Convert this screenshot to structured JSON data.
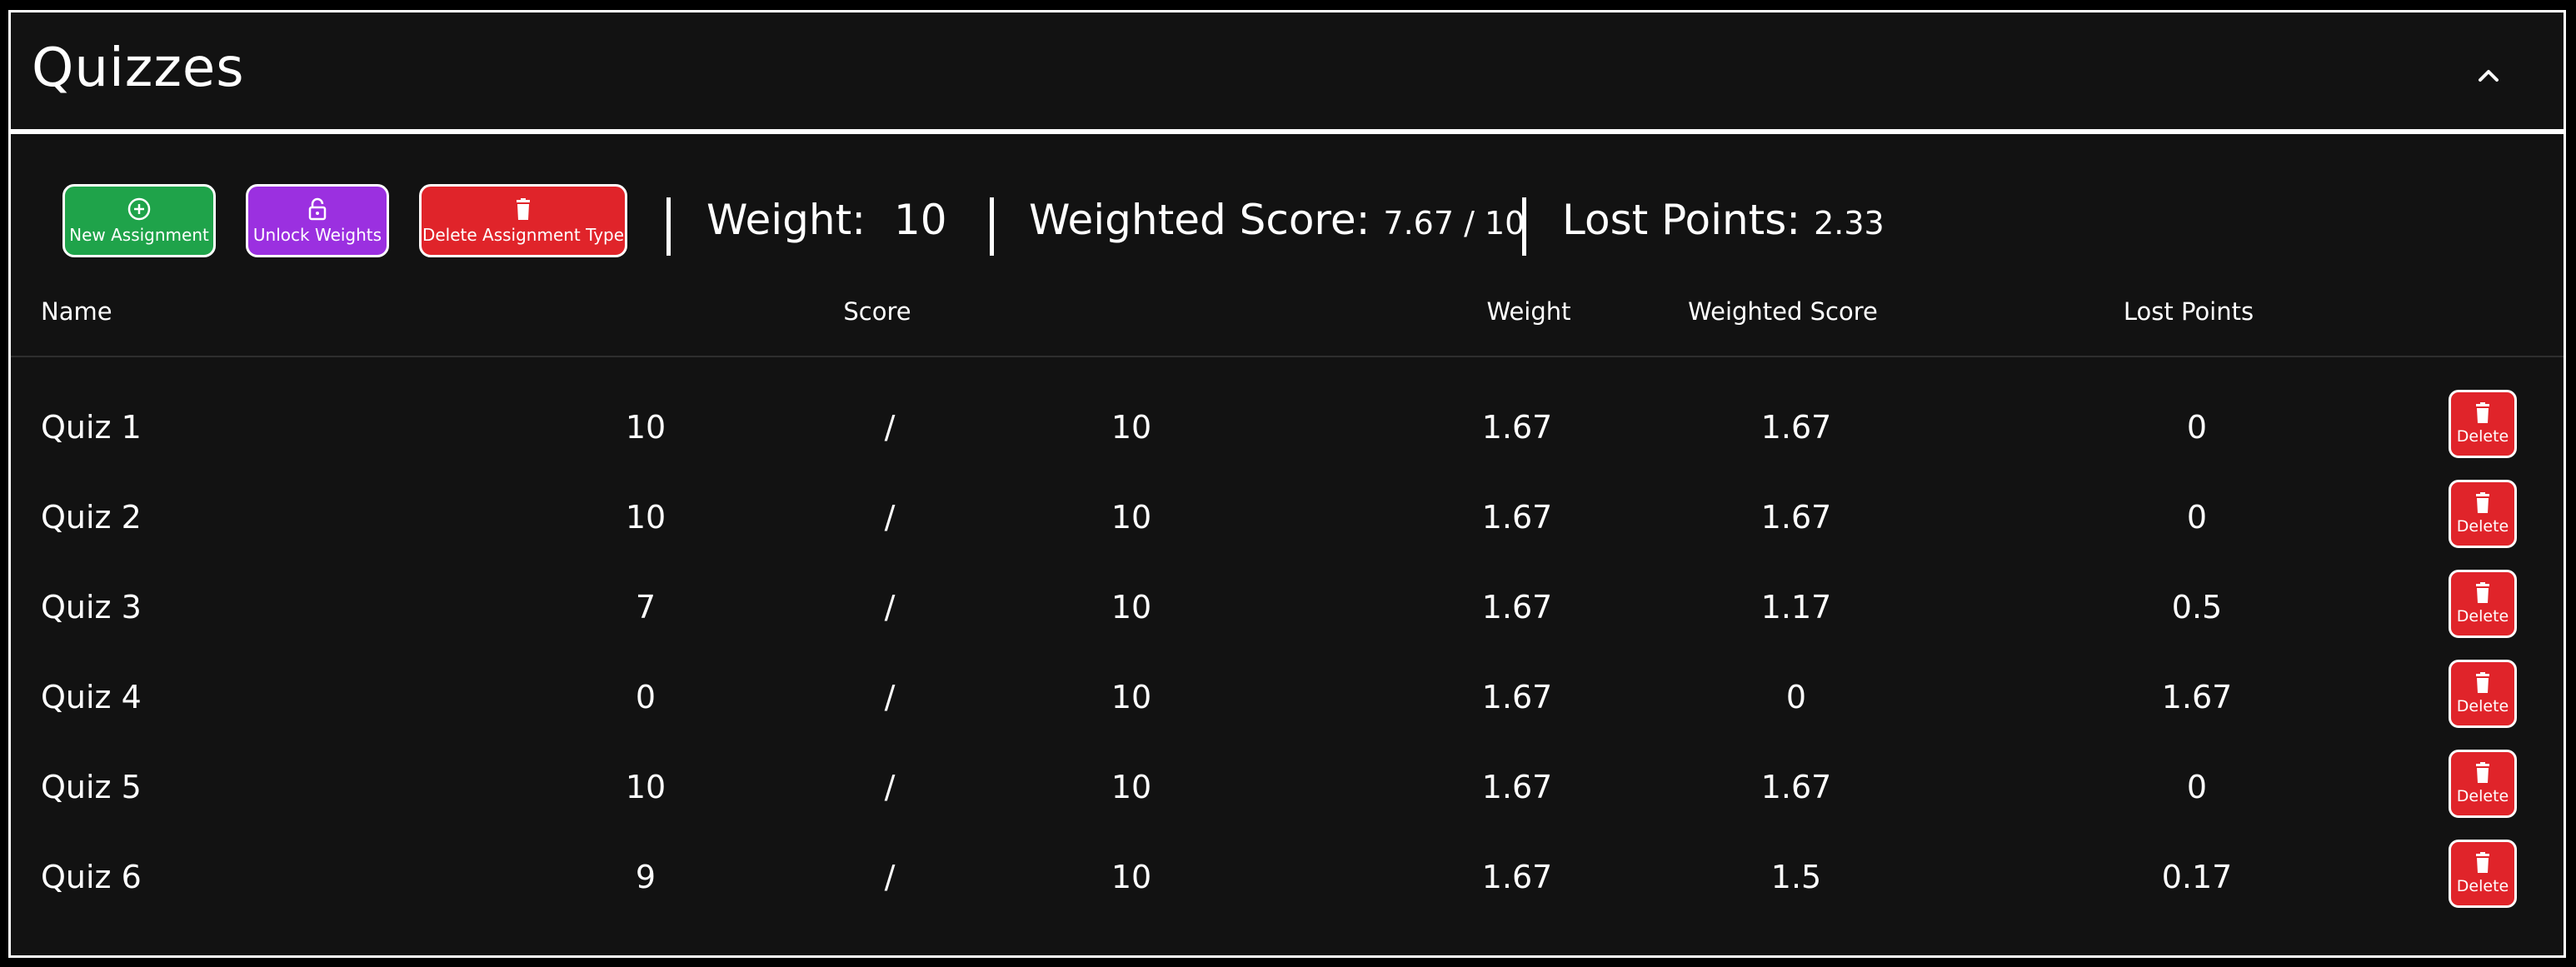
{
  "section": {
    "title": "Quizzes"
  },
  "toolbar": {
    "new_label": "New Assignment",
    "unlock_label": "Unlock Weights",
    "delete_type_label": "Delete Assignment Type",
    "weight_label": "Weight:",
    "weight_value": "10",
    "weighted_score_label": "Weighted Score:",
    "weighted_score_value": "7.67 / 10",
    "lost_points_label": "Lost Points:",
    "lost_points_value": "2.33"
  },
  "table": {
    "headers": {
      "name": "Name",
      "score": "Score",
      "weight": "Weight",
      "weighted_score": "Weighted Score",
      "lost_points": "Lost Points"
    },
    "delete_label": "Delete",
    "rows": [
      {
        "name": "Quiz 1",
        "score": "10",
        "sep": "/",
        "total": "10",
        "weight": "1.67",
        "weighted": "1.67",
        "lost": "0"
      },
      {
        "name": "Quiz 2",
        "score": "10",
        "sep": "/",
        "total": "10",
        "weight": "1.67",
        "weighted": "1.67",
        "lost": "0"
      },
      {
        "name": "Quiz 3",
        "score": "7",
        "sep": "/",
        "total": "10",
        "weight": "1.67",
        "weighted": "1.17",
        "lost": "0.5"
      },
      {
        "name": "Quiz 4",
        "score": "0",
        "sep": "/",
        "total": "10",
        "weight": "1.67",
        "weighted": "0",
        "lost": "1.67"
      },
      {
        "name": "Quiz 5",
        "score": "10",
        "sep": "/",
        "total": "10",
        "weight": "1.67",
        "weighted": "1.67",
        "lost": "0"
      },
      {
        "name": "Quiz 6",
        "score": "9",
        "sep": "/",
        "total": "10",
        "weight": "1.67",
        "weighted": "1.5",
        "lost": "0.17"
      }
    ]
  },
  "colors": {
    "green": "#1fa34a",
    "purple": "#9b30e0",
    "red": "#e0242a",
    "background": "#121212"
  },
  "icons": {
    "collapse": "chevron-up-icon",
    "new": "plus-circle-icon",
    "unlock": "unlock-icon",
    "delete": "trash-icon"
  }
}
